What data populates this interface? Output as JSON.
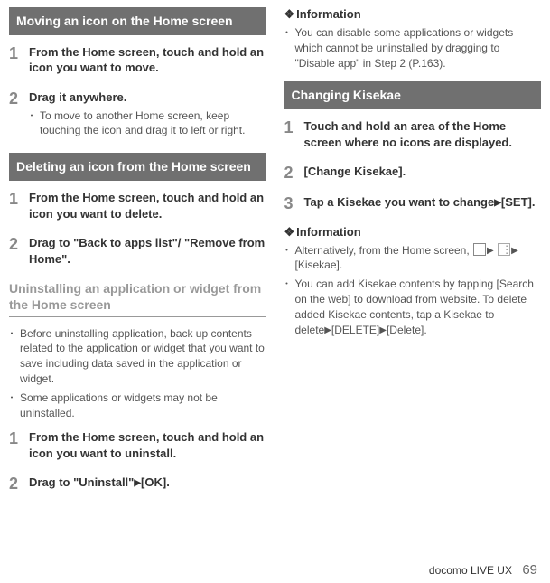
{
  "left": {
    "sectionA": {
      "title": "Moving an icon on the Home screen",
      "steps": [
        {
          "num": "1",
          "title": "From the Home screen, touch and hold an icon you want to move."
        },
        {
          "num": "2",
          "title": "Drag it anywhere.",
          "bullets": [
            "To move to another Home screen, keep touching the icon and drag it to left or right."
          ]
        }
      ]
    },
    "sectionB": {
      "title": "Deleting an icon from the Home screen",
      "steps": [
        {
          "num": "1",
          "title": "From the Home screen, touch and hold an icon you want to delete."
        },
        {
          "num": "2",
          "title": "Drag to \"Back to apps list\"/ \"Remove from Home\"."
        }
      ]
    },
    "sectionC": {
      "title": "Uninstalling an application or widget from the Home screen",
      "bullets": [
        "Before uninstalling application, back up contents related to the application or widget that you want to save including data saved in the application or widget.",
        "Some applications or widgets may not be uninstalled."
      ],
      "steps": [
        {
          "num": "1",
          "title": "From the Home screen, touch and hold an icon you want to uninstall."
        },
        {
          "num": "2",
          "title_html": "Drag to \"Uninstall\"▶[OK]."
        }
      ]
    }
  },
  "right": {
    "info1": {
      "heading": "Information",
      "bullets": [
        "You can disable some applications or widgets which cannot be uninstalled by dragging to \"Disable app\" in Step 2 (P.163)."
      ]
    },
    "sectionD": {
      "title": "Changing Kisekae",
      "steps": [
        {
          "num": "1",
          "title": "Touch and hold an area of the Home screen where no icons are displayed."
        },
        {
          "num": "2",
          "title": "[Change Kisekae]."
        },
        {
          "num": "3",
          "title_html": "Tap a Kisekae you want to change▶[SET]."
        }
      ]
    },
    "info2": {
      "heading": "Information",
      "item1_prefix": "Alternatively, from the Home screen, ",
      "item1_suffix": " [Kisekae].",
      "item2_html": "You can add Kisekae contents by tapping [Search on the web] to download from website. To delete added Kisekae contents, tap a Kisekae to delete▶[DELETE]▶[Delete]."
    }
  },
  "footer": {
    "label": "docomo LIVE UX",
    "page": "69"
  }
}
